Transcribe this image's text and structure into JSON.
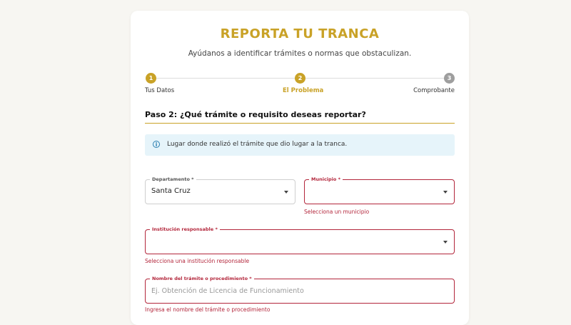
{
  "colors": {
    "accent": "#c9a227",
    "inactive_step": "#9e9e9e",
    "error": "#b3263b",
    "info_background": "#e6f4fa",
    "info_icon": "#2a7fb0",
    "page_background": "#f7f6f2"
  },
  "header": {
    "title": "REPORTA TU TRANCA",
    "subtitle": "Ayúdanos a identificar trámites o normas que obstaculizan."
  },
  "stepper": {
    "steps": [
      {
        "number": "1",
        "label": "Tus Datos",
        "state": "completed"
      },
      {
        "number": "2",
        "label": "El Problema",
        "state": "active"
      },
      {
        "number": "3",
        "label": "Comprobante",
        "state": "pending"
      }
    ]
  },
  "section": {
    "title": "Paso 2: ¿Qué trámite o requisito deseas reportar?"
  },
  "info": {
    "icon": "info-icon",
    "text": "Lugar donde realizó el trámite que dio lugar a la tranca."
  },
  "form": {
    "departamento": {
      "label": "Departamento *",
      "value": "Santa Cruz"
    },
    "municipio": {
      "label": "Municipio *",
      "value": "",
      "error": "Selecciona un municipio"
    },
    "institucion": {
      "label": "Institución responsable *",
      "value": "",
      "error": "Selecciona una institución responsable"
    },
    "tramite": {
      "label": "Nombre del trámite o procedimiento *",
      "value": "",
      "placeholder": "Ej. Obtención de Licencia de Funcionamiento",
      "error": "Ingresa el nombre del trámite o procedimiento"
    }
  }
}
